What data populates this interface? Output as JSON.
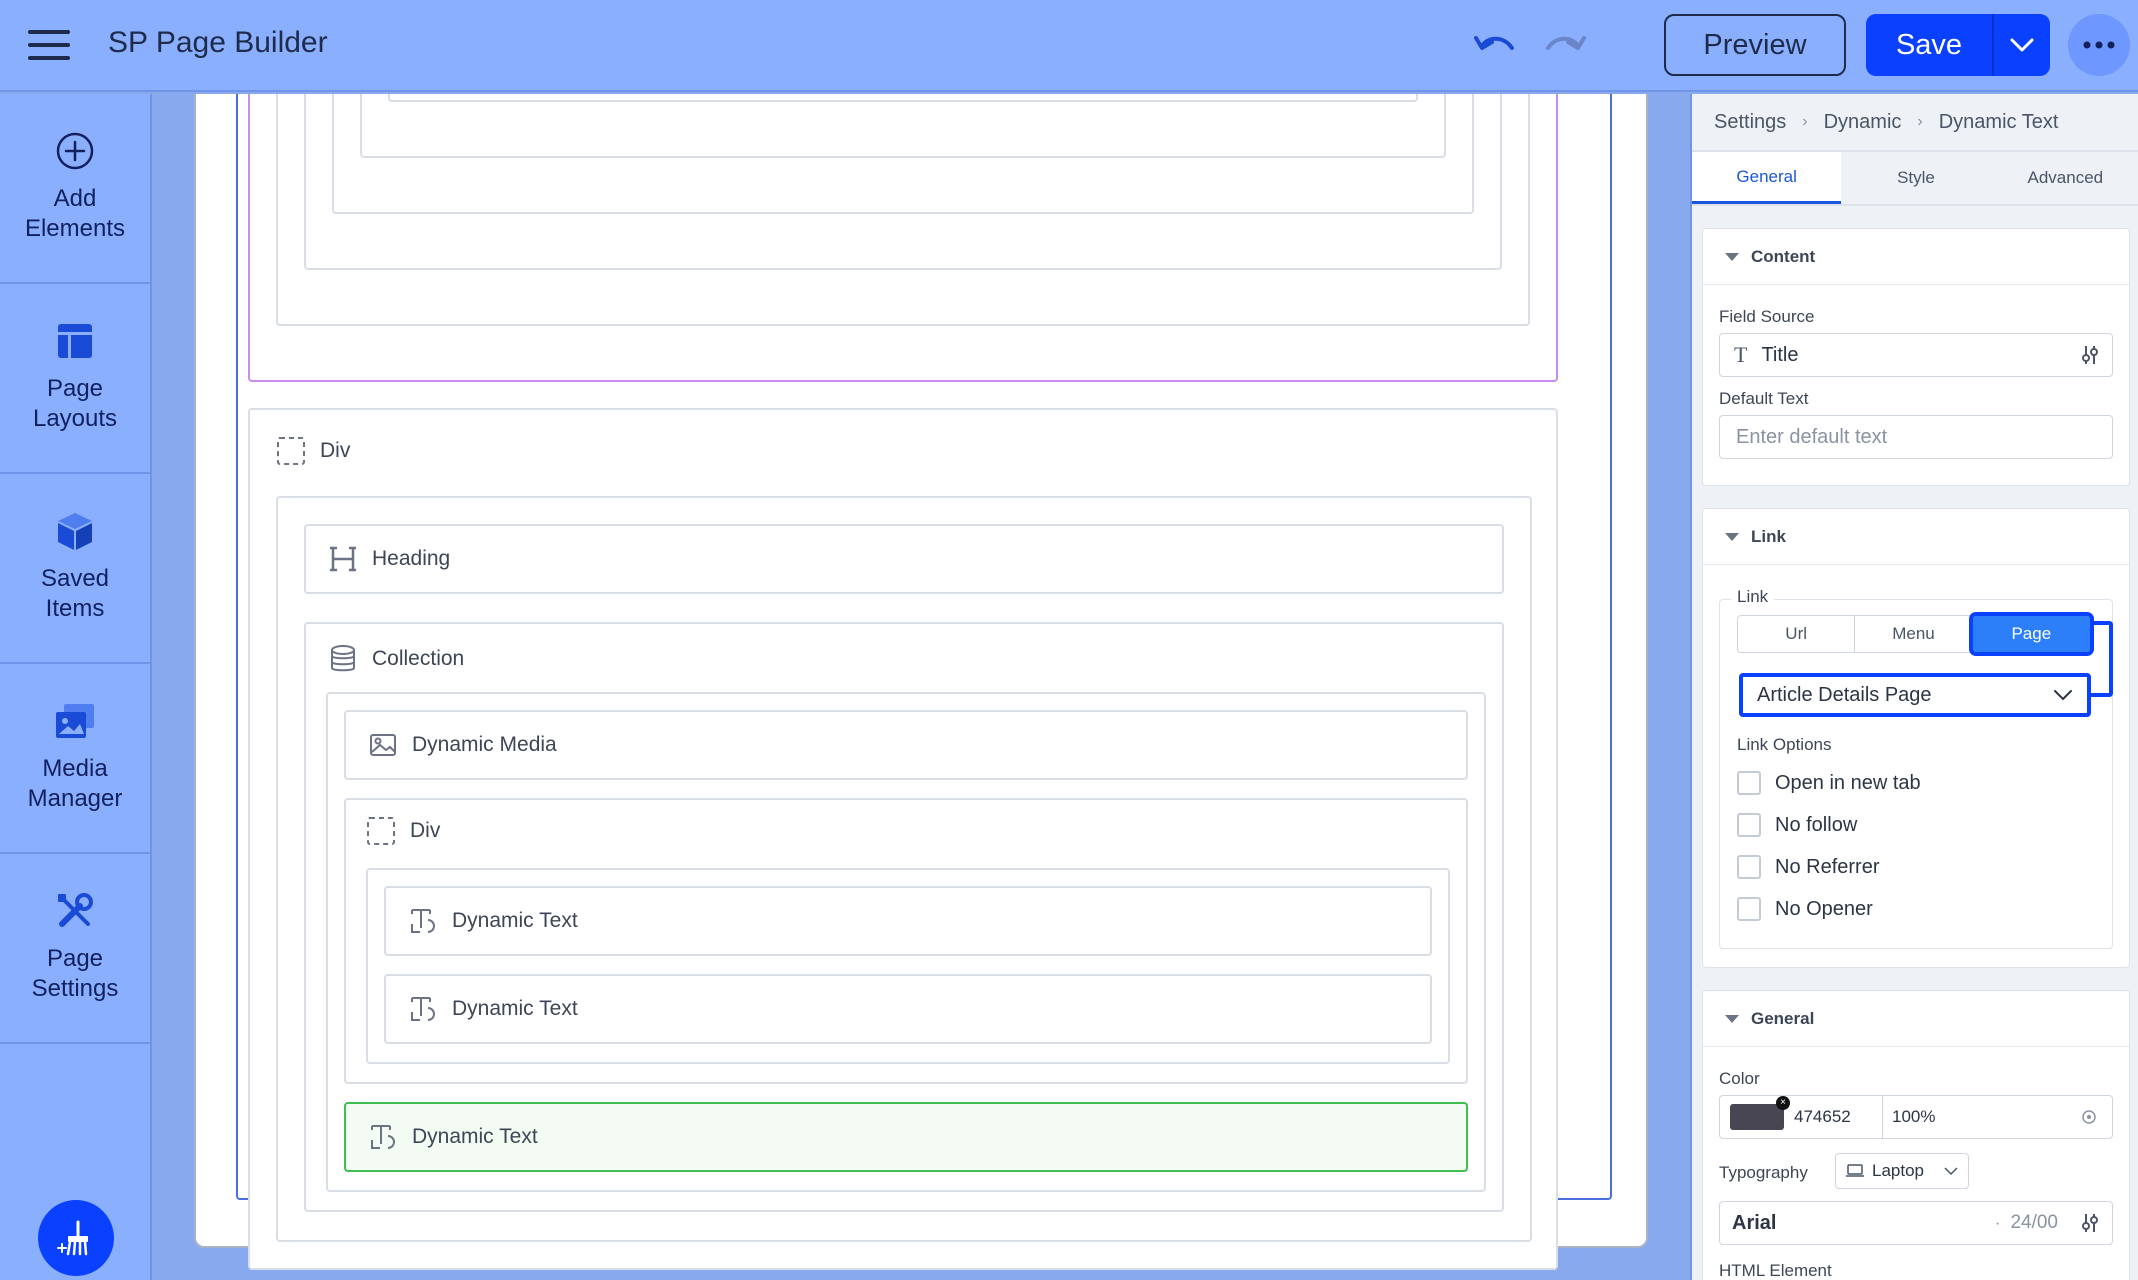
{
  "app": {
    "title": "SP Page Builder",
    "preview_label": "Preview",
    "save_label": "Save"
  },
  "sidebar": {
    "items": [
      {
        "label": "Add Elements",
        "icon": "plus-circle-icon"
      },
      {
        "label": "Page Layouts",
        "icon": "layout-icon"
      },
      {
        "label": "Saved Items",
        "icon": "cube-icon"
      },
      {
        "label": "Media Manager",
        "icon": "media-icon"
      },
      {
        "label": "Page Settings",
        "icon": "tools-icon"
      }
    ]
  },
  "canvas": {
    "div1_label": "Div",
    "heading_label": "Heading",
    "collection_label": "Collection",
    "dynamic_media_label": "Dynamic Media",
    "div2_label": "Div",
    "dynamic_text_1": "Dynamic Text",
    "dynamic_text_2": "Dynamic Text",
    "dynamic_text_3": "Dynamic Text"
  },
  "panel": {
    "breadcrumb": [
      "Settings",
      "Dynamic",
      "Dynamic Text"
    ],
    "tabs": [
      "General",
      "Style",
      "Advanced"
    ],
    "active_tab": "General",
    "content": {
      "title": "Content",
      "field_source_label": "Field Source",
      "field_source_value": "Title",
      "default_text_label": "Default Text",
      "default_text_placeholder": "Enter default text"
    },
    "link": {
      "title": "Link",
      "group_label": "Link",
      "options": [
        "Url",
        "Menu",
        "Page"
      ],
      "selected_option": "Page",
      "page_select_value": "Article Details Page",
      "link_options_label": "Link Options",
      "checkboxes": [
        "Open in new tab",
        "No follow",
        "No Referrer",
        "No Opener"
      ]
    },
    "general": {
      "title": "General",
      "color_label": "Color",
      "color_hex": "474652",
      "color_swatch": "#474652",
      "opacity": "100%",
      "typography_label": "Typography",
      "device": "Laptop",
      "font_name": "Arial",
      "font_size": "24/00",
      "html_element_label": "HTML Element"
    }
  },
  "colors": {
    "accent": "#0a40ff",
    "active_green": "#3fbf52"
  }
}
